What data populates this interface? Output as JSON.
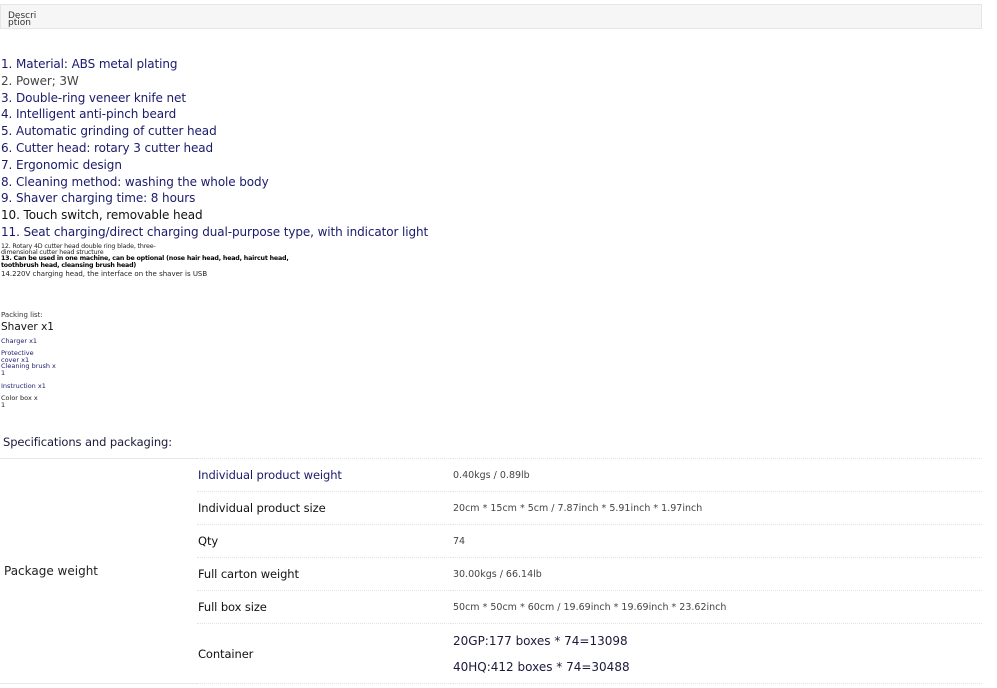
{
  "tabs": [
    {
      "label_line1": "Descri",
      "label_line2": "ption"
    }
  ],
  "description": {
    "features": [
      "1. Material: ABS metal plating",
      "2. Power; 3W",
      "3. Double-ring veneer knife net",
      "4. Intelligent anti-pinch beard",
      "5. Automatic grinding of cutter head",
      "6. Cutter head: rotary 3 cutter head",
      "7. Ergonomic design",
      "8. Cleaning method: washing the whole body",
      "9. Shaver charging time: 8 hours",
      "10. Touch switch, removable head",
      "11. Seat charging/direct charging dual-purpose type, with indicator light"
    ],
    "feature12_line1": "12. Rotary 4D cutter head double ring blade, three-",
    "feature12_line2": "dimensional cutter head structure",
    "feature13_line1": "13. Can be used in one machine, can be optional (nose hair head, head, haircut head,",
    "feature13_line2": "toothbrush head, cleansing brush head)",
    "feature14": "14.220V charging head, the interface on the shaver is USB"
  },
  "packing": {
    "title": "Packing list:",
    "shaver": "Shaver x1",
    "charger": "Charger x1",
    "cover_line1": "Protective",
    "cover_line2": "cover x1",
    "brush_line1": "Cleaning brush x",
    "brush_line2": "1",
    "instruction": "Instruction x1",
    "colorbox_line1": "Color box x",
    "colorbox_line2": "1"
  },
  "specs": {
    "title": "Specifications and packaging:",
    "group_label": "Package weight",
    "rows": [
      {
        "name": "Individual product weight",
        "value": "0.40kgs / 0.89lb"
      },
      {
        "name": "Individual product size",
        "value": "20cm * 15cm * 5cm / 7.87inch * 5.91inch * 1.97inch"
      },
      {
        "name": "Qty",
        "value": "74"
      },
      {
        "name": "Full carton weight",
        "value": "30.00kgs / 66.14lb"
      },
      {
        "name": "Full box size",
        "value": "50cm * 50cm * 60cm / 19.69inch * 19.69inch * 23.62inch"
      }
    ],
    "container": {
      "name": "Container",
      "value1": "20GP:177 boxes * 74=13098",
      "value2": "40HQ:412 boxes * 74=30488"
    }
  },
  "colors": {
    "navy_text": "#1a1a6b",
    "tabbar_bg": "#f6f6f6"
  }
}
